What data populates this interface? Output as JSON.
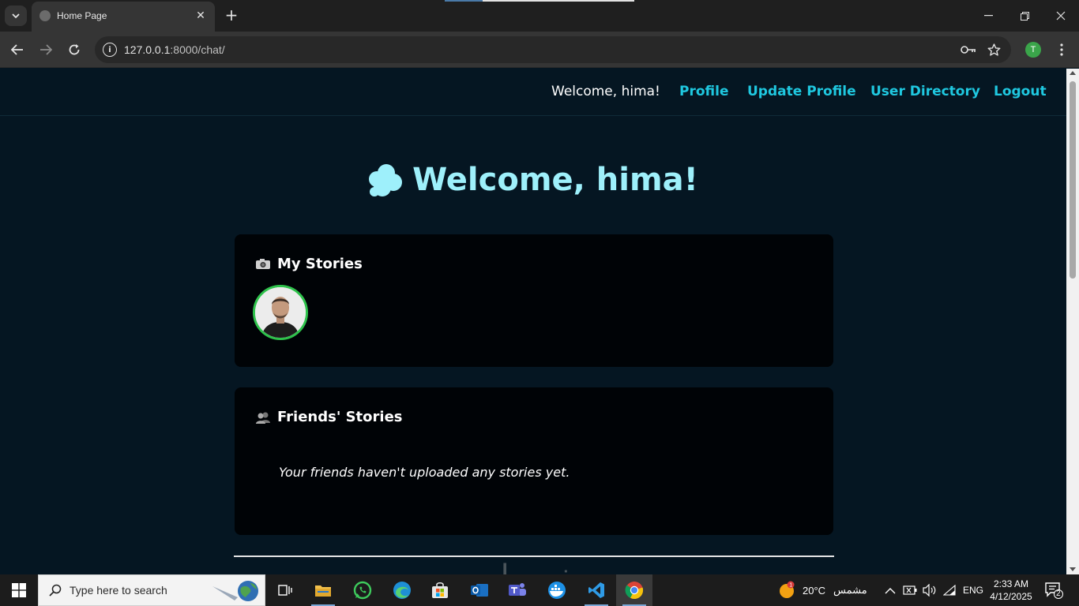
{
  "browser": {
    "tab_title": "Home Page",
    "url_host": "127.0.0.1",
    "url_path": ":8000/chat/",
    "profile_initial": "T"
  },
  "navbar": {
    "welcome": "Welcome, hima!",
    "links": [
      "Profile",
      "Update Profile",
      "User Directory",
      "Logout"
    ]
  },
  "hero": {
    "title": "Welcome, hima!"
  },
  "my_stories": {
    "icon": "camera-icon",
    "title": "My Stories"
  },
  "friends_stories": {
    "icon": "busts-icon",
    "title": "Friends' Stories",
    "empty_message": "Your friends haven't uploaded any stories yet."
  },
  "taskbar": {
    "search_placeholder": "Type here to search",
    "weather_temp": "20°C",
    "weather_desc": "مشمس",
    "language": "ENG",
    "time": "2:33 AM",
    "date": "4/12/2025",
    "notification_count": "2"
  },
  "colors": {
    "page_bg": "#051622",
    "card_bg": "#000306",
    "accent": "#1fc8e0",
    "hero_text": "#9ef0fb",
    "story_ring": "#2ec24b"
  }
}
